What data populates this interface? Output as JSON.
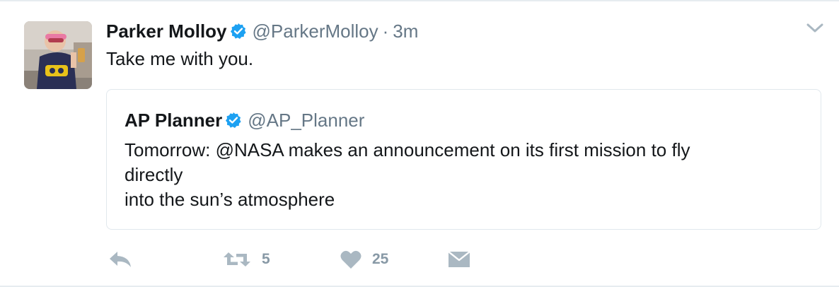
{
  "tweet": {
    "author_name": "Parker Molloy",
    "author_handle": "@ParkerMolloy",
    "separator": "·",
    "time": "3m",
    "text": "Take me with you.",
    "icons": {
      "avatar": "profile-photo",
      "verified": "verified-badge-icon",
      "menu": "chevron-down-icon"
    }
  },
  "quoted_tweet": {
    "author_name": "AP Planner",
    "author_handle": "@AP_Planner",
    "text_lines": [
      "Tomorrow: @NASA makes an announcement on its first mission to fly",
      "directly",
      "into the sun’s atmosphere"
    ]
  },
  "actions": {
    "reply": {
      "icon": "reply-icon"
    },
    "retweet": {
      "icon": "retweet-icon",
      "count": "5"
    },
    "like": {
      "icon": "heart-icon",
      "count": "25"
    },
    "message": {
      "icon": "envelope-icon"
    }
  },
  "colors": {
    "text": "#14171a",
    "secondary": "#657786",
    "action_icon": "#aab8c2",
    "verified": "#1da1f2",
    "border": "#e1e8ed"
  }
}
